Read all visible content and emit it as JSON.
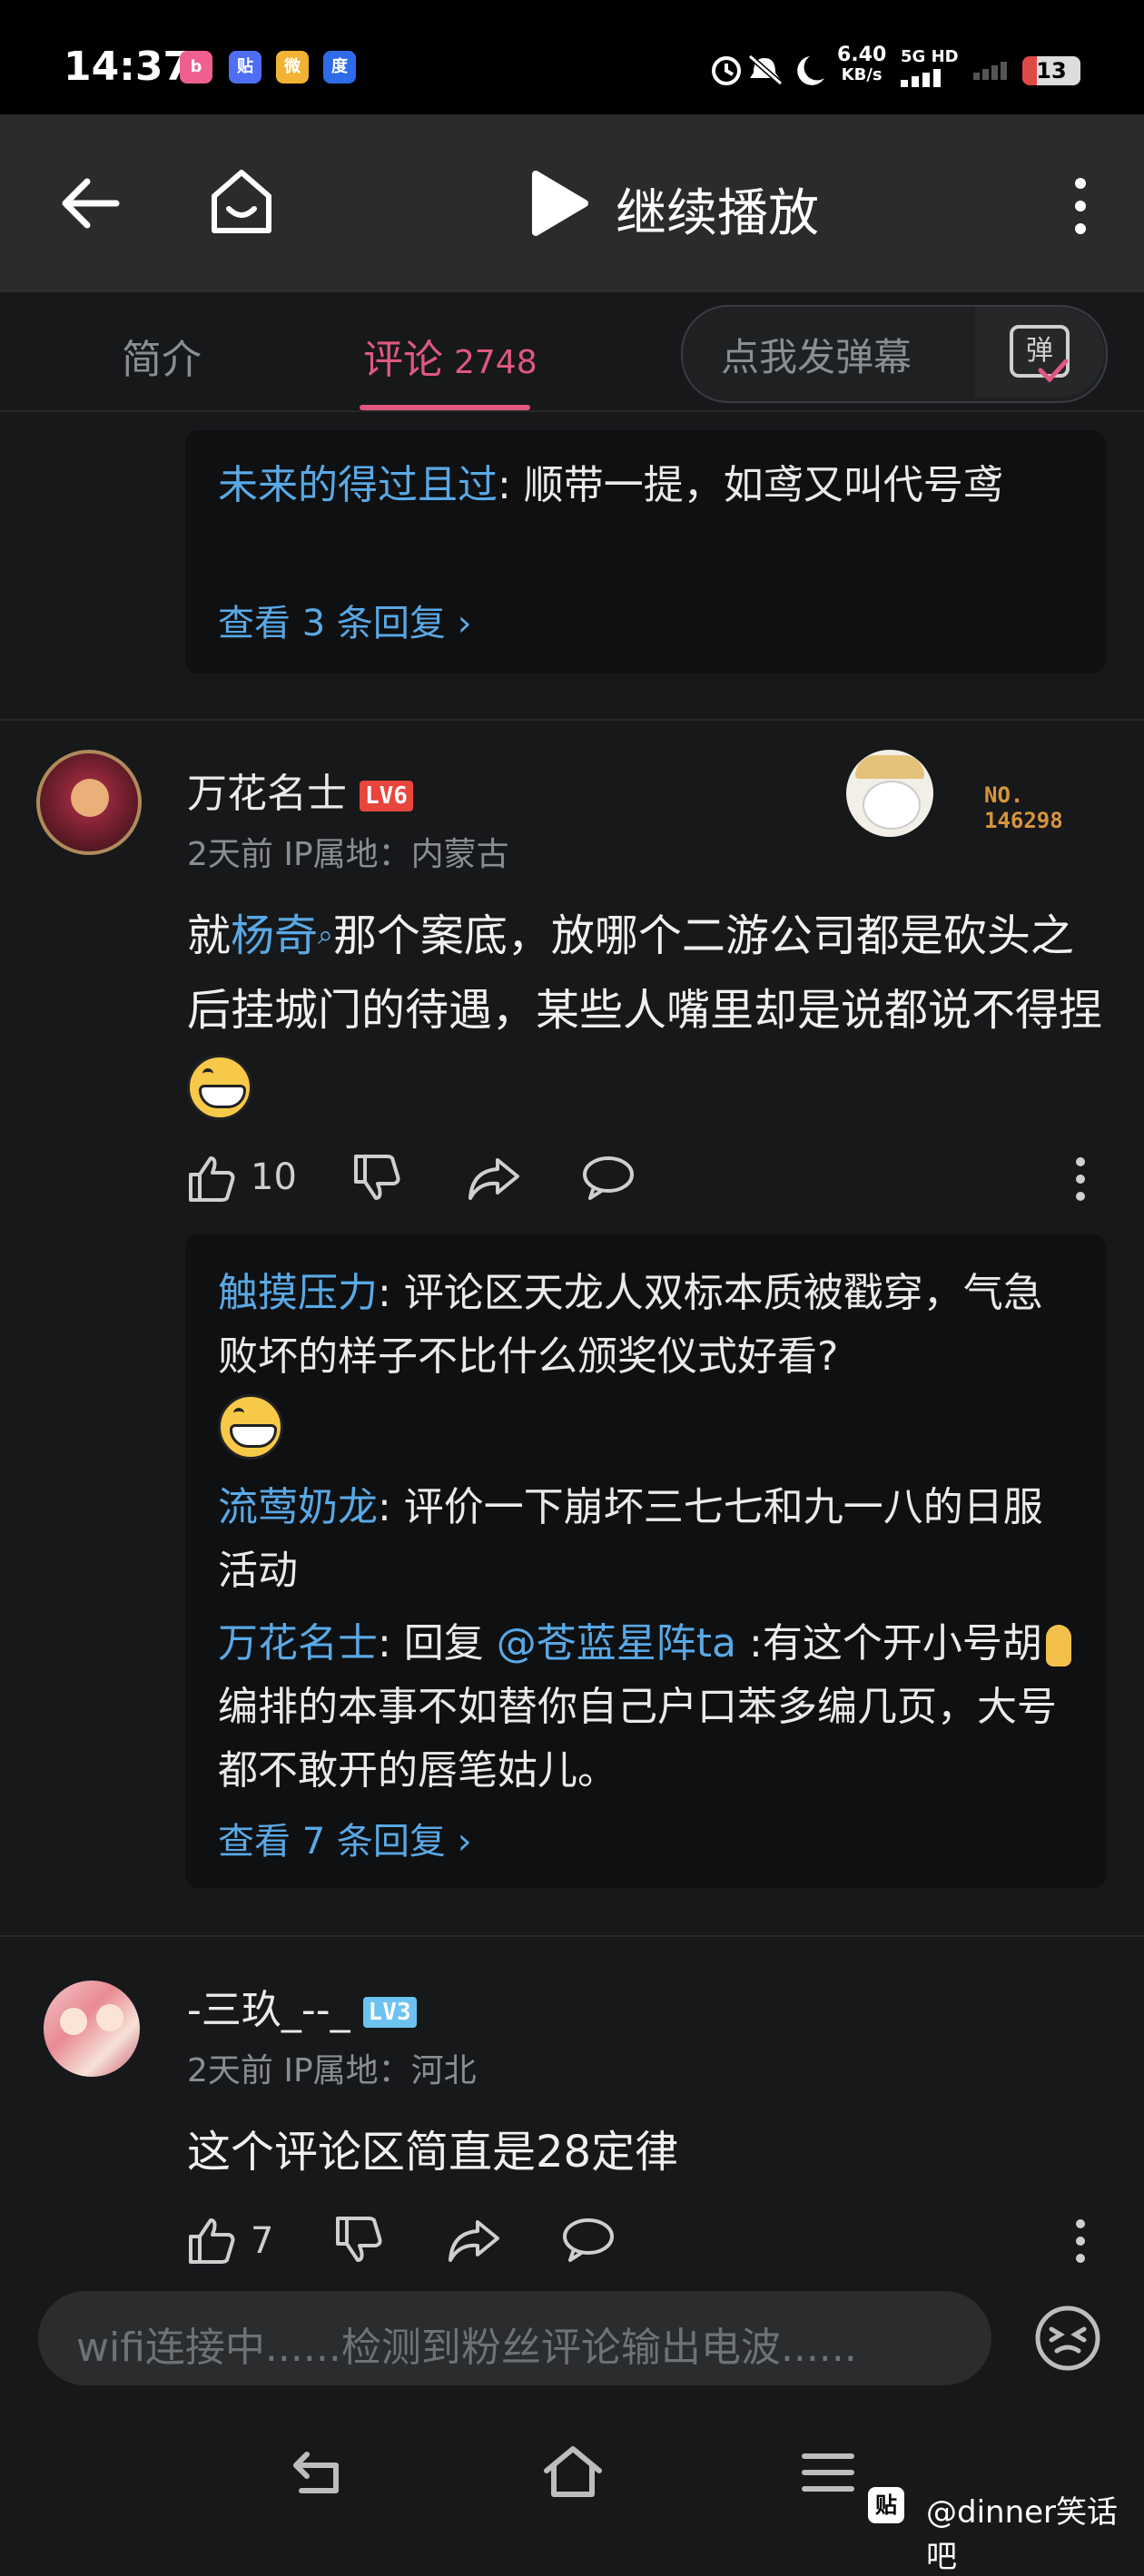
{
  "status_bar": {
    "time": "14:37",
    "net_speed_top": "6.40",
    "net_speed_bottom": "KB/s",
    "network": "5G HD",
    "battery": "13",
    "apps": [
      "bilibili-icon",
      "tieba-icon",
      "weibo-icon",
      "baidu-icon"
    ]
  },
  "nav": {
    "title": "继续播放"
  },
  "tabs": {
    "intro": "简介",
    "comments": "评论",
    "comment_count": "2748",
    "danmaku_placeholder": "点我发弹幕",
    "danmaku_btn": "弹"
  },
  "reply_top": {
    "user": "未来的得过且过",
    "text": ": 顺带一提，如鸢又叫代号鸢",
    "more": "查看 3 条回复 ›"
  },
  "comment1": {
    "name": "万花名士",
    "level": "LV6",
    "meta": "2天前 IP属地：内蒙古",
    "badge_label": "NO.",
    "badge_number": "146298",
    "body_pre": "就",
    "body_link": "杨奇",
    "body_post": "那个案底，放哪个二游公司都是砍头之后挂城门的待遇，某些人嘴里却是说都说不得捏",
    "likes": "10",
    "replies": [
      {
        "user": "触摸压力",
        "text": ": 评论区天龙人双标本质被戳穿，气急败坏的样子不比什么颁奖仪式好看?"
      },
      {
        "user": "流莺奶龙",
        "text": ": 评价一下崩坏三七七和九一八的日服活动"
      },
      {
        "user": "万花名士",
        "mention_prefix": ": 回复 ",
        "mention": "@苍蓝星阵ta",
        "text_a": " :有这个开小号胡",
        "text_b": "编排的本事不如替你自己户口苯多编几页，大号都不敢开的唇笔姑儿。"
      }
    ],
    "more": "查看 7 条回复 ›"
  },
  "comment2": {
    "name": "-三玖_--_",
    "level": "LV3",
    "meta": "2天前 IP属地：河北",
    "body": "这个评论区简直是28定律",
    "likes": "7"
  },
  "input": {
    "placeholder": "wifi连接中......检测到粉丝评论输出电波......"
  },
  "watermark": {
    "text": "@dinner笑话吧",
    "badge": "贴"
  },
  "colors": {
    "accent_pink": "#e0587f",
    "link_blue": "#59a9e6",
    "lv6_red": "#e8453c",
    "lv3_blue": "#6cc3f0",
    "badge_gold": "#d7953a"
  }
}
